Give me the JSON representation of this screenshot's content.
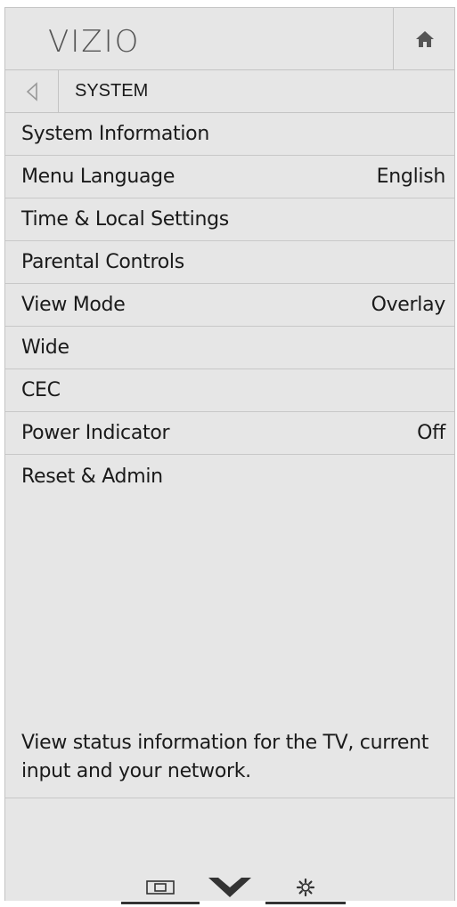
{
  "header": {
    "logo_text": "VIZIO",
    "home_icon": "home-icon"
  },
  "breadcrumb": {
    "back_icon": "back-arrow-icon",
    "label": "SYSTEM"
  },
  "menu": {
    "items": [
      {
        "label": "System Information",
        "value": ""
      },
      {
        "label": "Menu Language",
        "value": "English"
      },
      {
        "label": "Time & Local Settings",
        "value": ""
      },
      {
        "label": "Parental Controls",
        "value": ""
      },
      {
        "label": "View Mode",
        "value": "Overlay"
      },
      {
        "label": "Wide",
        "value": ""
      },
      {
        "label": "CEC",
        "value": ""
      },
      {
        "label": "Power Indicator",
        "value": "Off"
      },
      {
        "label": "Reset & Admin",
        "value": ""
      }
    ]
  },
  "description": "View status information for the TV, current input and your network.",
  "footer": {
    "buttons": [
      {
        "icon": "picture-in-picture-icon"
      },
      {
        "icon": "vizio-v-icon"
      },
      {
        "icon": "gear-icon"
      }
    ]
  },
  "colors": {
    "panel_background": "#e6e6e6",
    "border": "#c4c4c4",
    "text": "#1a1a1a",
    "logo": "#555555"
  }
}
